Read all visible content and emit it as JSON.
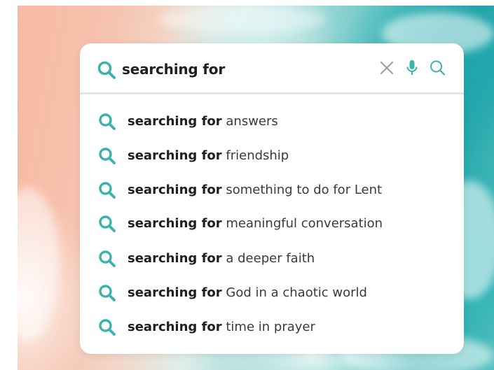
{
  "search": {
    "query": "searching for",
    "icons": {
      "lead": "search-icon",
      "clear": "close-icon",
      "voice": "microphone-icon",
      "submit": "search-icon"
    },
    "accent_color": "#3bb3ad"
  },
  "suggestions": [
    {
      "prefix": "searching for",
      "completion": "answers"
    },
    {
      "prefix": "searching for",
      "completion": "friendship"
    },
    {
      "prefix": "searching for",
      "completion": "something to do for Lent"
    },
    {
      "prefix": "searching for",
      "completion": "meaningful conversation"
    },
    {
      "prefix": "searching for",
      "completion": "a deeper faith"
    },
    {
      "prefix": "searching for",
      "completion": "God in a chaotic world"
    },
    {
      "prefix": "searching for",
      "completion": "time in prayer"
    }
  ]
}
